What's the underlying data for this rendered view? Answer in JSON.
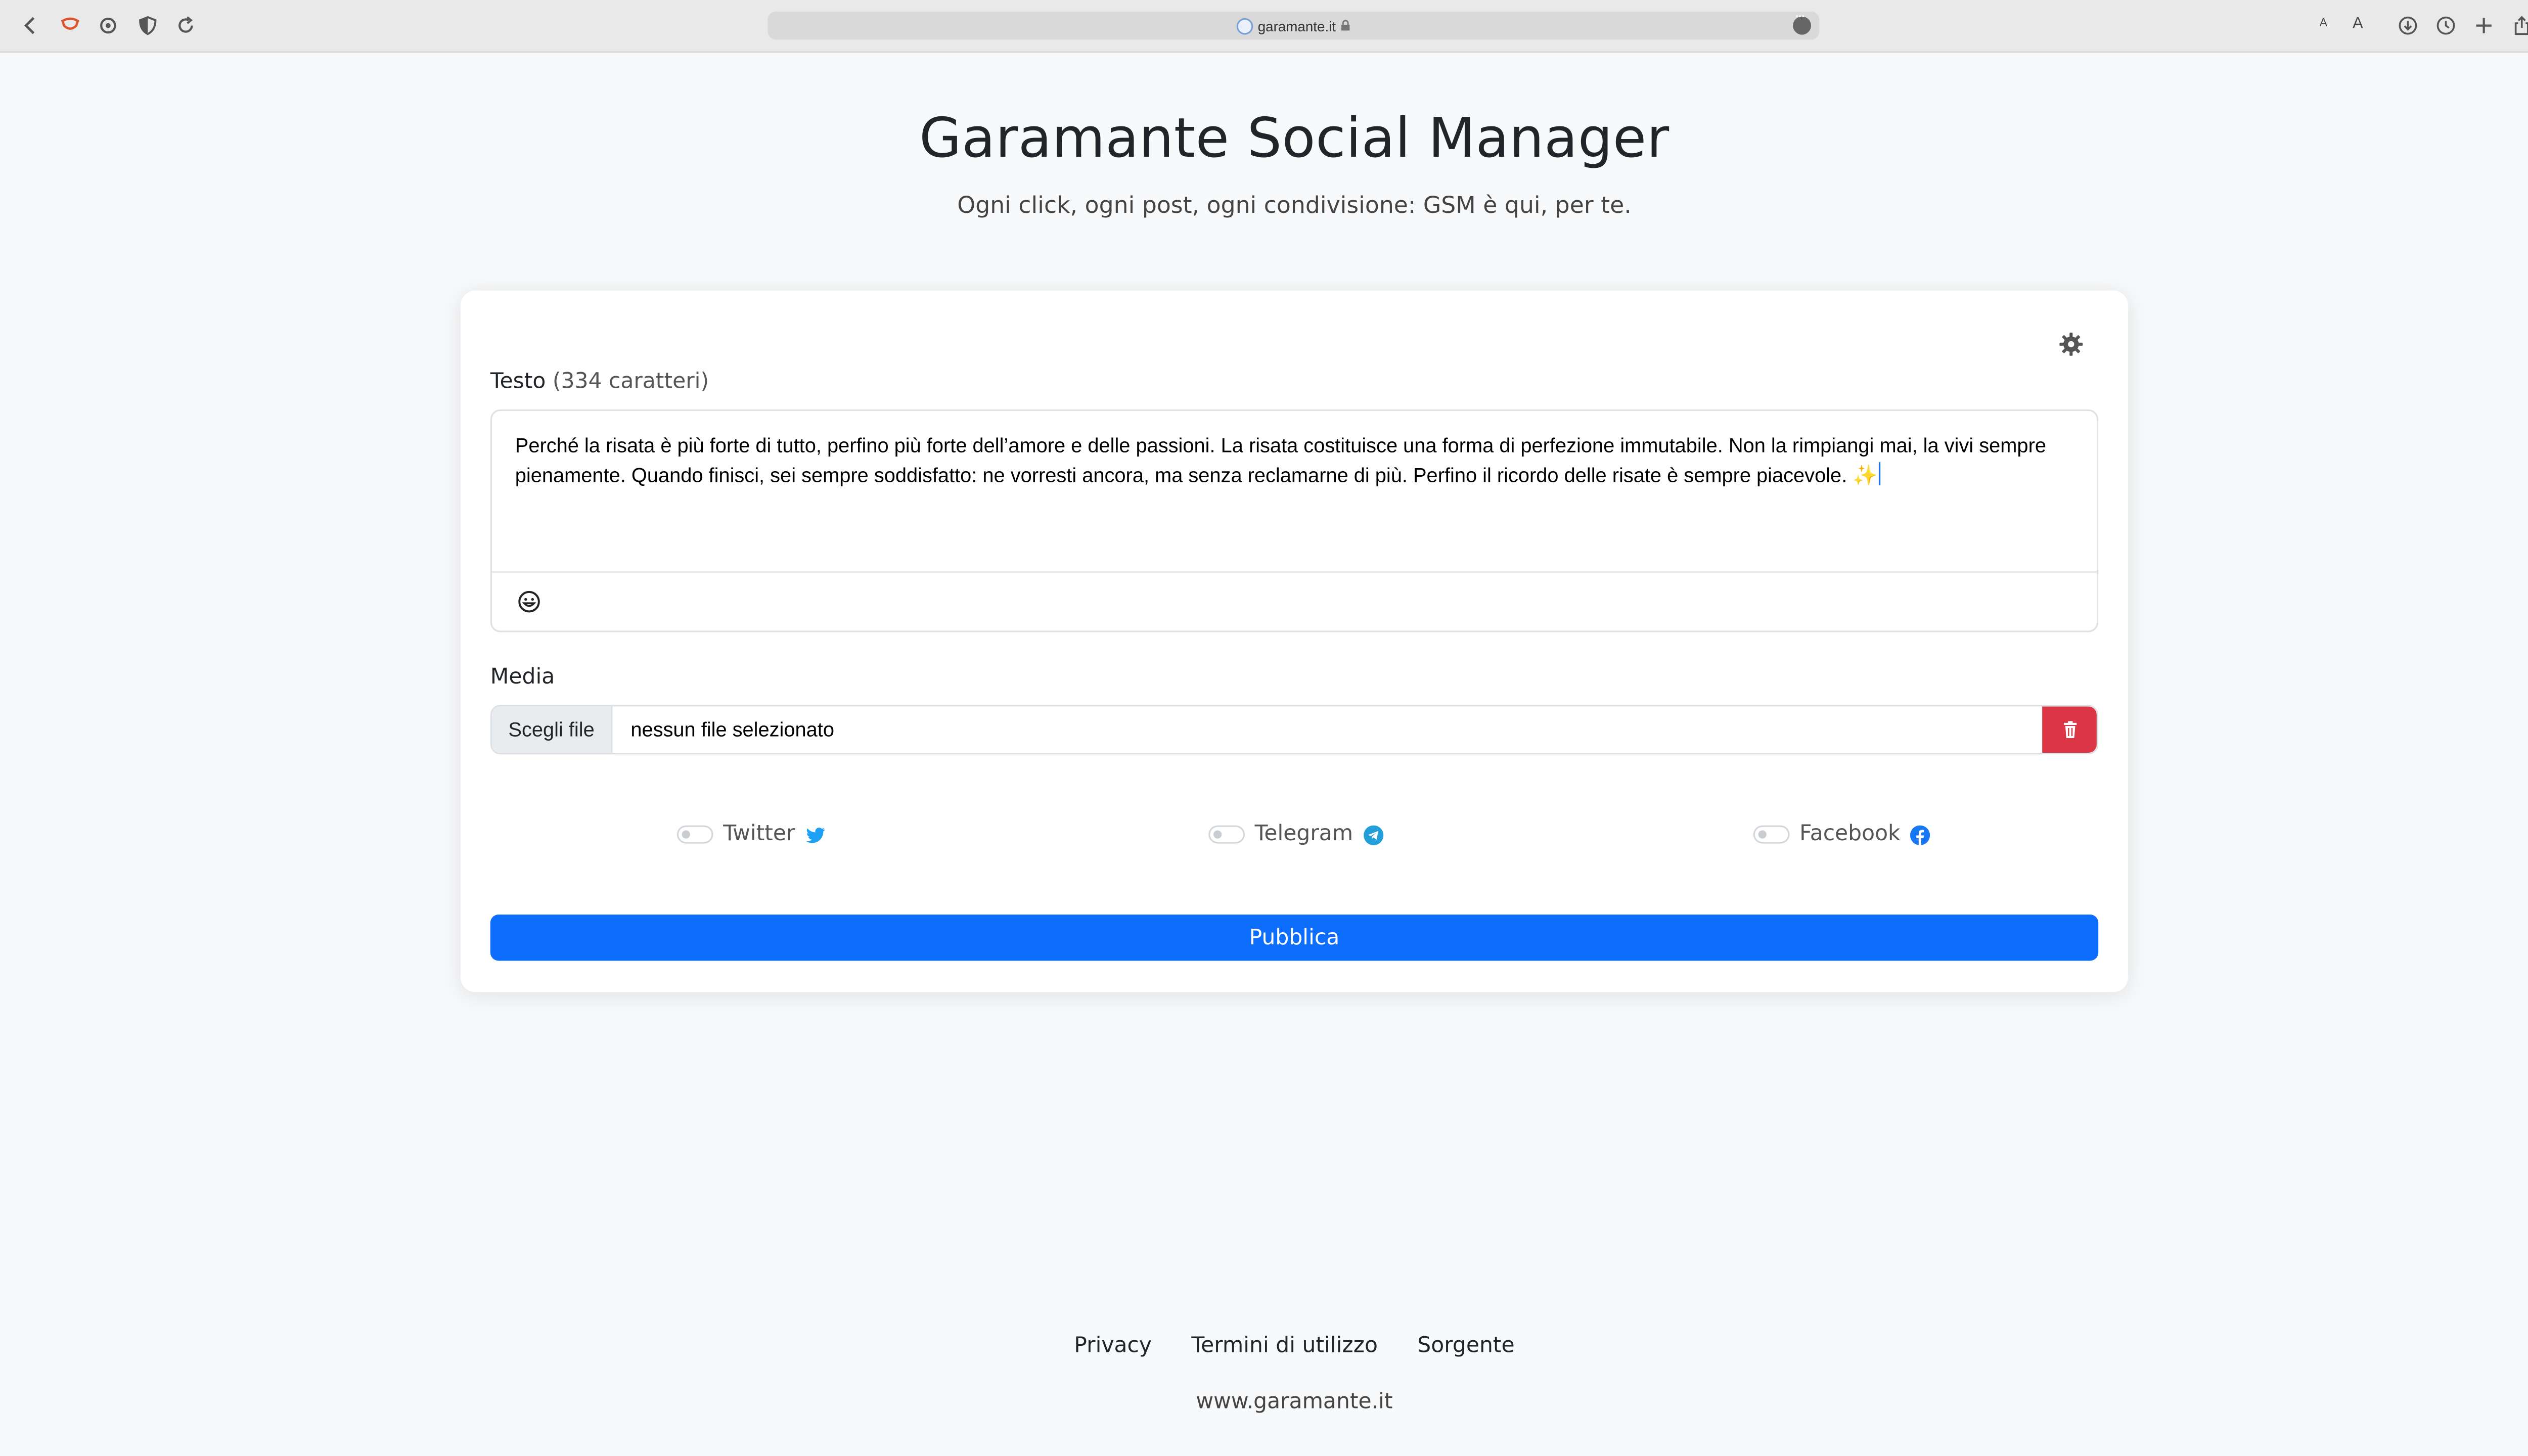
{
  "browser": {
    "url": "garamante.it",
    "text_size_small": "A",
    "text_size_large": "A"
  },
  "header": {
    "title": "Garamante Social Manager",
    "subtitle": "Ogni click, ogni post, ogni condivisione: GSM è qui, per te."
  },
  "composer": {
    "text_label": "Testo",
    "char_count": "(334 caratteri)",
    "text_value": "Perché la risata è più forte di tutto, perfino più forte dell’amore e delle passioni. La risata costituisce una forma di perfezione immutabile. Non la rimpiangi mai, la vivi sempre pienamente. Quando finisci, sei sempre soddisfatto: ne vorresti ancora, ma senza reclamarne di più. Perfino il ricordo delle risate è sempre piacevole.",
    "text_emoji": "✨",
    "media_label": "Media",
    "choose_file_label": "Scegli file",
    "no_file_text": "nessun file selezionato",
    "services": [
      {
        "name": "Twitter",
        "enabled": false,
        "icon": "twitter-icon"
      },
      {
        "name": "Telegram",
        "enabled": false,
        "icon": "telegram-icon"
      },
      {
        "name": "Facebook",
        "enabled": false,
        "icon": "facebook-icon"
      }
    ],
    "publish_label": "Pubblica"
  },
  "footer": {
    "links": [
      "Privacy",
      "Termini di utilizzo",
      "Sorgente"
    ],
    "site": "www.garamante.it"
  },
  "colors": {
    "primary": "#0d6efd",
    "danger": "#dc3545",
    "twitter": "#1da1f2",
    "telegram": "#229ed9",
    "facebook": "#1877f2"
  }
}
